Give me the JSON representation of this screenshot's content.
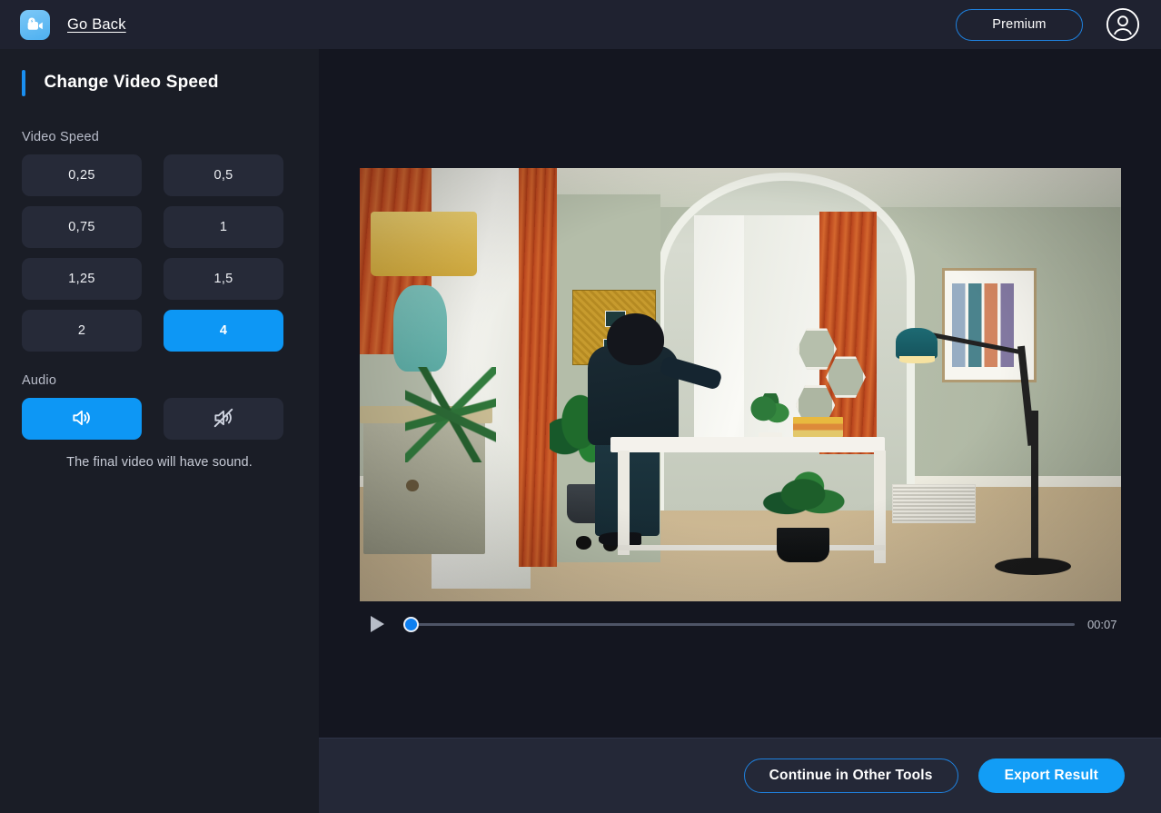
{
  "header": {
    "logo_icon": "video-camera-logo-icon",
    "go_back_label": "Go Back",
    "premium_label": "Premium",
    "avatar_icon": "user-avatar-icon"
  },
  "sidebar": {
    "panel_title": "Change Video Speed",
    "speed_section_label": "Video Speed",
    "speed_options": [
      {
        "label": "0,25",
        "selected": false
      },
      {
        "label": "0,5",
        "selected": false
      },
      {
        "label": "0,75",
        "selected": false
      },
      {
        "label": "1",
        "selected": false
      },
      {
        "label": "1,25",
        "selected": false
      },
      {
        "label": "1,5",
        "selected": false
      },
      {
        "label": "2",
        "selected": false
      },
      {
        "label": "4",
        "selected": true
      }
    ],
    "audio_section_label": "Audio",
    "audio_options": [
      {
        "icon": "speaker-on-icon",
        "selected": true
      },
      {
        "icon": "speaker-muted-icon",
        "selected": false
      }
    ],
    "audio_note": "The final video will have sound."
  },
  "player": {
    "play_icon": "play-icon",
    "progress_percent": 0,
    "time_label": "00:07",
    "scene_description": "Woman with dark curly hair standing at a white desk in a sage-green home office with orange curtains, hexagon wall shelves, framed photo collage, floor lamp and potted plants"
  },
  "footer": {
    "continue_label": "Continue in Other Tools",
    "export_label": "Export Result"
  },
  "colors": {
    "accent_blue": "#0d97f5",
    "outline_blue": "#1f82e0",
    "header_bg": "#1f2230",
    "sidebar_bg": "#1a1d26",
    "main_bg": "#141620",
    "footer_bg": "#242837",
    "button_bg": "#262a38"
  }
}
